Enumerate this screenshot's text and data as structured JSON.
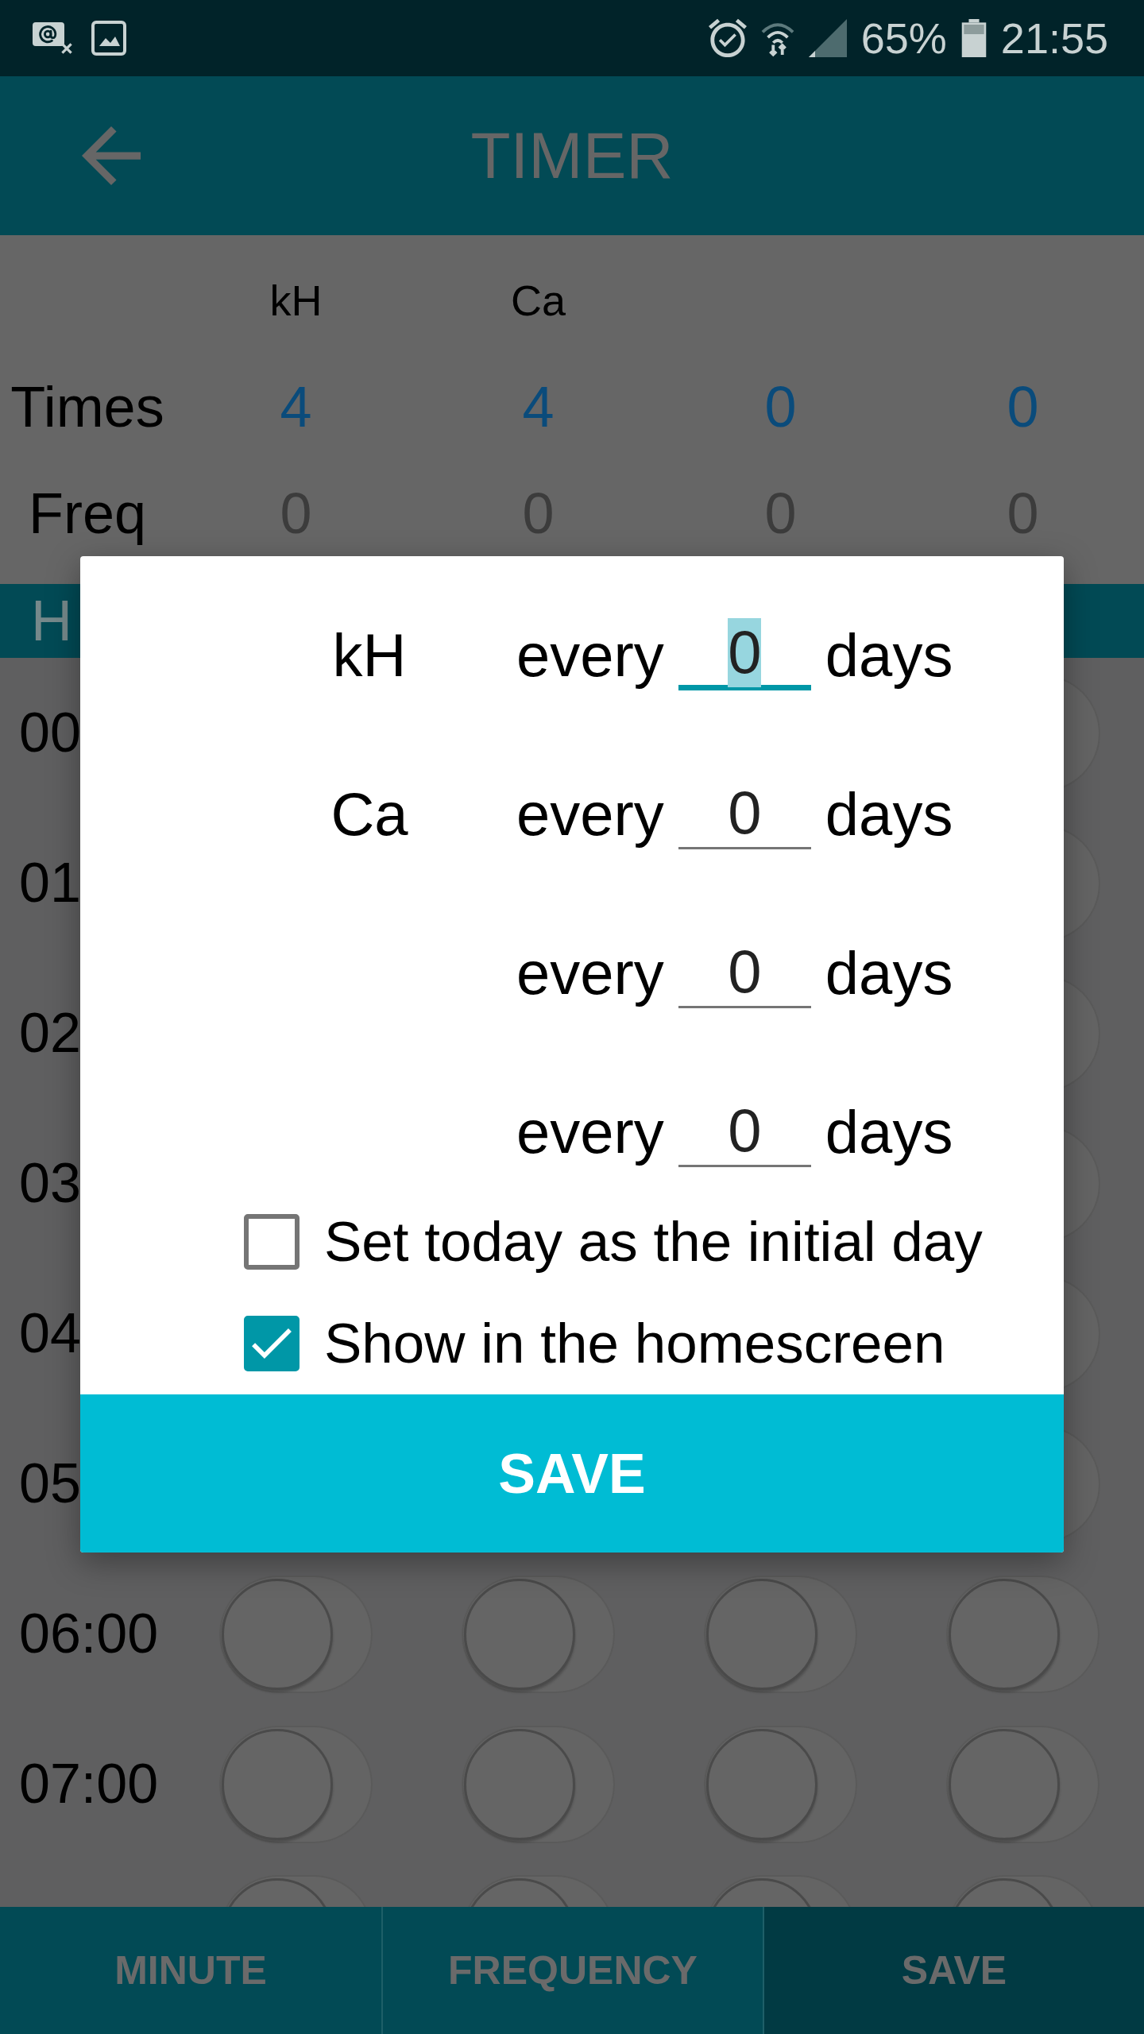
{
  "status_bar": {
    "battery_percent": "65%",
    "time": "21:55"
  },
  "app_bar": {
    "title": "TIMER"
  },
  "summary": {
    "row_labels": {
      "times": "Times",
      "freq": "Freq"
    },
    "columns": [
      {
        "header": "kH",
        "times": "4",
        "freq": "0"
      },
      {
        "header": "Ca",
        "times": "4",
        "freq": "0"
      },
      {
        "times": "0",
        "freq": "0"
      },
      {
        "times": "0",
        "freq": "0"
      }
    ]
  },
  "section_bar": {
    "label": "H"
  },
  "list": {
    "rows": [
      {
        "kind": "covered",
        "time": "00",
        "switches": [
          {
            "on": false
          }
        ]
      },
      {
        "kind": "covered",
        "time": "01",
        "switches": [
          {
            "on": false
          }
        ]
      },
      {
        "kind": "covered",
        "time": "02",
        "switches": [
          {
            "on": false
          }
        ]
      },
      {
        "kind": "covered",
        "time": "03",
        "switches": [
          {
            "on": false
          }
        ]
      },
      {
        "kind": "covered",
        "time": "04",
        "switches": [
          {
            "on": false
          }
        ]
      },
      {
        "kind": "covered",
        "time": "05",
        "switches": [
          {
            "on": false
          }
        ]
      },
      {
        "kind": "full",
        "time": "06:00",
        "switches": [
          {
            "on": false
          },
          {
            "on": false
          },
          {
            "on": false
          },
          {
            "on": false
          }
        ]
      },
      {
        "kind": "full",
        "time": "07:00",
        "switches": [
          {
            "on": false
          },
          {
            "on": false
          },
          {
            "on": false
          },
          {
            "on": false
          }
        ]
      },
      {
        "kind": "cut",
        "switches": [
          {
            "on": false
          },
          {
            "on": false
          },
          {
            "on": false
          },
          {
            "on": false
          }
        ]
      }
    ]
  },
  "dialog": {
    "rows": [
      {
        "label": "kH",
        "prefix": "every",
        "value": "0",
        "suffix": "days",
        "focused": true
      },
      {
        "label": "Ca",
        "prefix": "every",
        "value": "0",
        "suffix": "days",
        "focused": false
      },
      {
        "prefix": "every",
        "value": "0",
        "suffix": "days",
        "focused": false
      },
      {
        "prefix": "every",
        "value": "0",
        "suffix": "days",
        "focused": false
      }
    ],
    "checkboxes": [
      {
        "label": "Set today as the initial day",
        "checked": false
      },
      {
        "label": "Show in the homescreen",
        "checked": true
      }
    ],
    "button": "SAVE"
  },
  "bottom_bar": {
    "buttons": [
      {
        "label": "MINUTE",
        "kind": "plain"
      },
      {
        "label": "FREQUENCY",
        "kind": "plain"
      },
      {
        "label": "SAVE",
        "kind": "primary"
      }
    ]
  }
}
